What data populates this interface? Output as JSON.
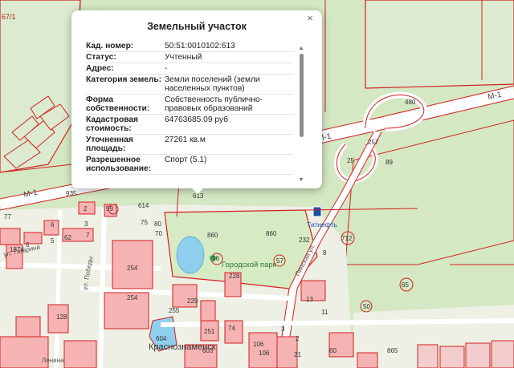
{
  "popup": {
    "title": "Земельный участок",
    "close_glyph": "×",
    "scroll_up_glyph": "▲",
    "scroll_down_glyph": "▼",
    "rows": [
      {
        "key": "Кад. номер:",
        "value": "50:51:0010102:613"
      },
      {
        "key": "Статус:",
        "value": "Учтенный"
      },
      {
        "key": "Адрес:",
        "value": "-"
      },
      {
        "key": "Категория земель:",
        "value": "Земли поселений (земли населенных пунктов)"
      },
      {
        "key": "Форма собственности:",
        "value": "Собственность публично-правовых образований"
      },
      {
        "key": "Кадастровая стоимость:",
        "value": "64763685.09 руб"
      },
      {
        "key": "Уточненная площадь:",
        "value": "27261 кв.м"
      },
      {
        "key": "Разрешенное использование:",
        "value": "Спорт (5.1)"
      }
    ]
  },
  "map": {
    "colors": {
      "forest": "#cfe6bd",
      "open": "#eef0e6",
      "parcel_border": "#d21f1f",
      "building": "#f6b3b3",
      "road": "#ffffff",
      "water": "#8fcfee"
    },
    "labels": {
      "top_left_code": "67/1",
      "road_m1_west": "М-1",
      "road_m1_east": "М-1",
      "road_m1_mid": "М-1",
      "park": "Городской парк",
      "city": "Краснознаменск",
      "station": "Татнефть",
      "street_a": "Пинская ул.",
      "street_b": "ул. Гагарина",
      "street_c": "ул. Победы",
      "street_d": "Ленина"
    },
    "parcel_numbers": [
      "613",
      "480",
      "257",
      "25",
      "89",
      "935",
      "2",
      "59",
      "614",
      "3",
      "77",
      "6",
      "5",
      "62",
      "7",
      "1874",
      "75",
      "80",
      "70",
      "860",
      "860",
      "232",
      "712",
      "8",
      "254",
      "254",
      "56",
      "228",
      "57",
      "13",
      "65",
      "50",
      "128",
      "255",
      "229",
      "251",
      "74",
      "3",
      "2",
      "21",
      "865",
      "604",
      "603",
      "106",
      "106",
      "60",
      "6",
      "11"
    ]
  }
}
